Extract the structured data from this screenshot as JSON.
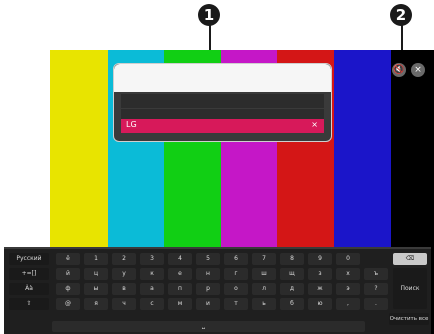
{
  "callouts": [
    "1",
    "2"
  ],
  "colors": {
    "bars": [
      "#ffffff",
      "#e8e400",
      "#0bbbd7",
      "#11cf14",
      "#c517c7",
      "#d41616",
      "#1b15c9",
      "#000000"
    ],
    "highlight": "#d7195a"
  },
  "search": {
    "input_value": "",
    "suggestions": [
      "",
      "",
      "LG"
    ],
    "clear_glyph": "×"
  },
  "top_buttons": {
    "mic_icon": "🔇",
    "close_icon": "×"
  },
  "keyboard": {
    "language": "Русский",
    "symbols": "+=[]",
    "case": "Àà",
    "shift_glyph": "⇧",
    "row1": [
      "ё",
      "1",
      "2",
      "3",
      "4",
      "5",
      "6",
      "7",
      "8",
      "9",
      "0"
    ],
    "row2": [
      "й",
      "ц",
      "у",
      "к",
      "е",
      "н",
      "г",
      "ш",
      "щ",
      "з",
      "х",
      "ъ"
    ],
    "row3": [
      "ф",
      "ы",
      "в",
      "а",
      "п",
      "р",
      "о",
      "л",
      "д",
      "ж",
      "э",
      "?"
    ],
    "row4": [
      "@",
      "я",
      "ч",
      "с",
      "м",
      "и",
      "т",
      "ь",
      "б",
      "ю",
      ",",
      "."
    ],
    "backspace_glyph": "⌫",
    "search_label": "Поиск",
    "clear_all_label": "Очистить все",
    "space_glyph": "⎵"
  }
}
